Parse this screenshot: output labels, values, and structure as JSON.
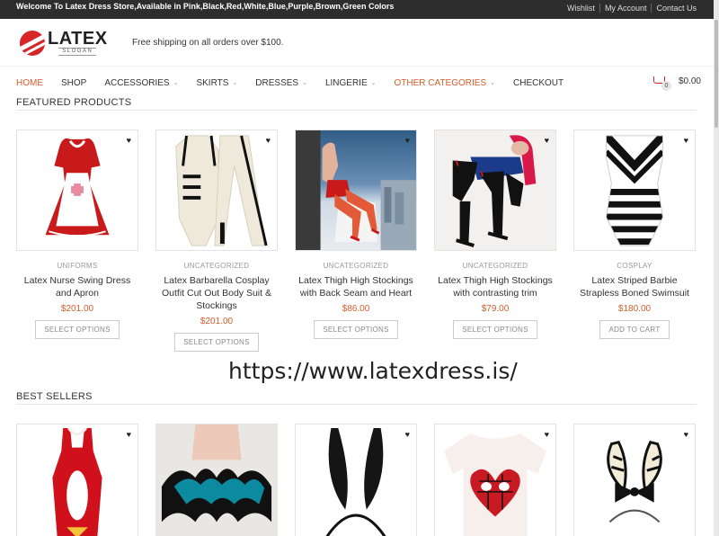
{
  "topbar": {
    "welcome": "Welcome To Latex Dress Store,Available in Pink,Black,Red,White,Blue,Purple,Brown,Green Colors",
    "links": [
      "Wishlist",
      "My Account",
      "Contact Us"
    ]
  },
  "header": {
    "logo_brand": "LATEX",
    "logo_slogan": "SLOGAN",
    "shipping_notice": "Free shipping on all orders over $100."
  },
  "nav": {
    "items": [
      {
        "label": "HOME"
      },
      {
        "label": "SHOP"
      },
      {
        "label": "ACCESSORIES"
      },
      {
        "label": "SKIRTS"
      },
      {
        "label": "DRESSES"
      },
      {
        "label": "LINGERIE"
      },
      {
        "label": "OTHER CATEGORIES"
      },
      {
        "label": "CHECKOUT"
      }
    ],
    "cart_count": "0",
    "cart_total": "$0.00"
  },
  "featured": {
    "title": "FEATURED PRODUCTS",
    "products": [
      {
        "category": "UNIFORMS",
        "title": "Latex Nurse Swing Dress and Apron",
        "price": "$201.00",
        "button": "SELECT OPTIONS"
      },
      {
        "category": "UNCATEGORIZED",
        "title": "Latex Barbarella Cosplay Outfit Cut Out Body Suit & Stockings",
        "price": "$201.00",
        "button": "SELECT OPTIONS"
      },
      {
        "category": "UNCATEGORIZED",
        "title": "Latex Thigh High Stockings with Back Seam and Heart",
        "price": "$86.00",
        "button": "SELECT OPTIONS"
      },
      {
        "category": "UNCATEGORIZED",
        "title": "Latex Thigh High Stockings with contrasting trim",
        "price": "$79.00",
        "button": "SELECT OPTIONS"
      },
      {
        "category": "COSPLAY",
        "title": "Latex Striped Barbie Strapless Boned Swimsuit",
        "price": "$180.00",
        "button": "ADD TO CART"
      }
    ]
  },
  "watermark_url": "https://www.latexdress.is/",
  "bestsellers": {
    "title": "BEST SELLERS"
  },
  "colors": {
    "accent": "#d65c2b",
    "topbar": "#2d2d2d",
    "brand_red": "#d62628"
  }
}
